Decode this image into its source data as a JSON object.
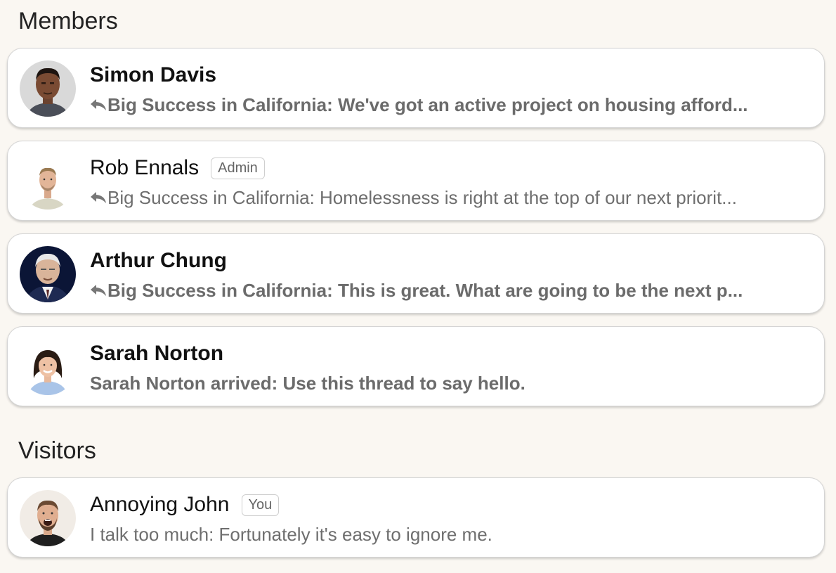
{
  "members": {
    "heading": "Members",
    "items": [
      {
        "name": "Simon Davis",
        "badge": "",
        "has_reply_icon": true,
        "preview": "Big Success in California: We've got an active project on housing afford...",
        "unread": true,
        "avatar_icon": "person-photo-avatar"
      },
      {
        "name": "Rob Ennals",
        "badge": "Admin",
        "has_reply_icon": true,
        "preview": "Big Success in California: Homelessness is right at the top of our next priorit...",
        "unread": false,
        "avatar_icon": "person-photo-avatar"
      },
      {
        "name": "Arthur Chung",
        "badge": "",
        "has_reply_icon": true,
        "preview": "Big Success in California: This is great. What are going to be the next p...",
        "unread": true,
        "avatar_icon": "person-photo-avatar"
      },
      {
        "name": "Sarah Norton",
        "badge": "",
        "has_reply_icon": false,
        "preview": "Sarah Norton arrived: Use this thread to say hello.",
        "unread": true,
        "avatar_icon": "person-photo-avatar"
      }
    ]
  },
  "visitors": {
    "heading": "Visitors",
    "items": [
      {
        "name": "Annoying John",
        "badge": "You",
        "has_reply_icon": false,
        "preview": "I talk too much: Fortunately it's easy to ignore me.",
        "unread": false,
        "avatar_icon": "person-photo-avatar"
      }
    ]
  },
  "icons": {
    "reply": "reply-arrow-icon"
  },
  "colors": {
    "page_background": "#faf7f2",
    "card_background": "#ffffff",
    "card_border": "#d4d4d4",
    "preview_text": "#6e6e6e",
    "name_text": "#111111"
  }
}
